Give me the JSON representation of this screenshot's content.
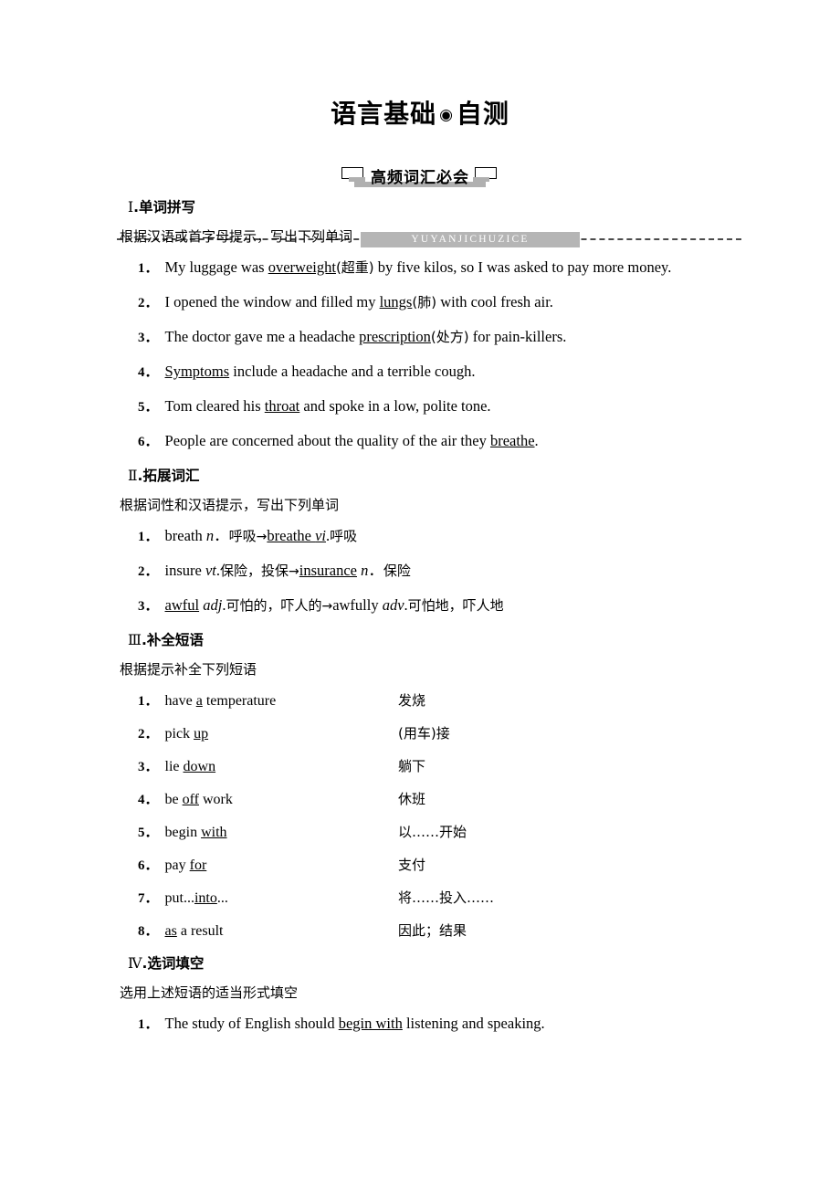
{
  "banner": {
    "title_left": "语言基础",
    "title_sep": "◉",
    "title_right": "自测",
    "pinyin": "YUYANJICHUZICE"
  },
  "subbanner": {
    "label": "高频词汇必会"
  },
  "sections": [
    {
      "numeral": "Ⅰ",
      "dot": ".",
      "heading": "单词拼写",
      "instruction": "根据汉语或首字母提示，写出下列单词",
      "items": [
        {
          "num": "1．",
          "parts": [
            {
              "t": "My luggage was ",
              "s": "plain"
            },
            {
              "t": "overweight",
              "s": "u"
            },
            {
              "t": "(超重)",
              "s": "zh"
            },
            {
              "t": " by five kilos, so I was asked to pay more money.",
              "s": "plain"
            }
          ]
        },
        {
          "num": "2．",
          "parts": [
            {
              "t": "I opened the window and filled my ",
              "s": "plain"
            },
            {
              "t": "lungs",
              "s": "u"
            },
            {
              "t": "(肺)",
              "s": "zh"
            },
            {
              "t": " with cool fresh air.",
              "s": "plain"
            }
          ]
        },
        {
          "num": "3．",
          "parts": [
            {
              "t": "The doctor gave me a headache ",
              "s": "plain"
            },
            {
              "t": "prescription",
              "s": "u"
            },
            {
              "t": "(处方)",
              "s": "zh"
            },
            {
              "t": " for pain-killers.",
              "s": "plain"
            }
          ]
        },
        {
          "num": "4．",
          "parts": [
            {
              "t": "Symptoms",
              "s": "u"
            },
            {
              "t": " include a headache and a terrible cough.",
              "s": "plain"
            }
          ]
        },
        {
          "num": "5．",
          "parts": [
            {
              "t": "Tom cleared his ",
              "s": "plain"
            },
            {
              "t": "throat",
              "s": "u"
            },
            {
              "t": " and spoke in a low, polite tone.",
              "s": "plain"
            }
          ]
        },
        {
          "num": "6．",
          "parts": [
            {
              "t": "People are concerned about the quality of the air they ",
              "s": "plain"
            },
            {
              "t": "breathe",
              "s": "u"
            },
            {
              "t": ".",
              "s": "plain"
            }
          ]
        }
      ]
    },
    {
      "numeral": "Ⅱ",
      "dot": ".",
      "heading": "拓展词汇",
      "instruction": "根据词性和汉语提示，写出下列单词",
      "items": [
        {
          "num": "1．",
          "parts": [
            {
              "t": "breath ",
              "s": "plain"
            },
            {
              "t": "n",
              "s": "it"
            },
            {
              "t": "．",
              "s": "plain"
            },
            {
              "t": "呼吸",
              "s": "zh"
            },
            {
              "t": "→",
              "s": "arrow"
            },
            {
              "t": "breathe ",
              "s": "u"
            },
            {
              "t": "vi",
              "s": "u-it"
            },
            {
              "t": ".",
              "s": "plain"
            },
            {
              "t": "呼吸",
              "s": "zh"
            }
          ]
        },
        {
          "num": "2．",
          "parts": [
            {
              "t": "insure ",
              "s": "plain"
            },
            {
              "t": "vt",
              "s": "it"
            },
            {
              "t": ".",
              "s": "plain"
            },
            {
              "t": "保险，投保",
              "s": "zh"
            },
            {
              "t": "→",
              "s": "arrow"
            },
            {
              "t": "insurance",
              "s": "u"
            },
            {
              "t": " ",
              "s": "plain"
            },
            {
              "t": "n",
              "s": "it"
            },
            {
              "t": "．",
              "s": "plain"
            },
            {
              "t": "保险",
              "s": "zh"
            }
          ]
        },
        {
          "num": "3．",
          "parts": [
            {
              "t": "awful",
              "s": "u"
            },
            {
              "t": " ",
              "s": "plain"
            },
            {
              "t": "adj",
              "s": "it"
            },
            {
              "t": ".",
              "s": "plain"
            },
            {
              "t": "可怕的，吓人的",
              "s": "zh"
            },
            {
              "t": "→",
              "s": "arrow"
            },
            {
              "t": "awfully ",
              "s": "plain"
            },
            {
              "t": "adv",
              "s": "it"
            },
            {
              "t": ".",
              "s": "plain"
            },
            {
              "t": "可怕地，吓人地",
              "s": "zh"
            }
          ]
        }
      ]
    },
    {
      "numeral": "Ⅲ",
      "dot": ".",
      "heading": "补全短语",
      "instruction": "根据提示补全下列短语",
      "phrases": [
        {
          "num": "1．",
          "pre": "have ",
          "key": "a",
          "post": " temperature",
          "cn": "发烧"
        },
        {
          "num": "2．",
          "pre": "pick ",
          "key": "up",
          "post": "",
          "cn": "(用车)接"
        },
        {
          "num": "3．",
          "pre": "lie ",
          "key": "down",
          "post": "",
          "cn": "躺下"
        },
        {
          "num": "4．",
          "pre": "be ",
          "key": "off",
          "post": " work",
          "cn": "休班"
        },
        {
          "num": "5．",
          "pre": "begin ",
          "key": "with",
          "post": "",
          "cn": "以……开始"
        },
        {
          "num": "6．",
          "pre": "pay ",
          "key": "for",
          "post": "",
          "cn": "支付"
        },
        {
          "num": "7．",
          "pre": "put...",
          "key": "into",
          "post": "...",
          "cn": "将……投入……"
        },
        {
          "num": "8．",
          "pre": "",
          "key": "as",
          "post": " a result",
          "cn": "因此；结果"
        }
      ]
    },
    {
      "numeral": "Ⅳ",
      "dot": ".",
      "heading": "选词填空",
      "instruction": "选用上述短语的适当形式填空",
      "items": [
        {
          "num": "1．",
          "parts": [
            {
              "t": "The study of English should ",
              "s": "plain"
            },
            {
              "t": "begin with",
              "s": "u"
            },
            {
              "t": " listening and speaking.",
              "s": "plain"
            }
          ]
        }
      ]
    }
  ]
}
